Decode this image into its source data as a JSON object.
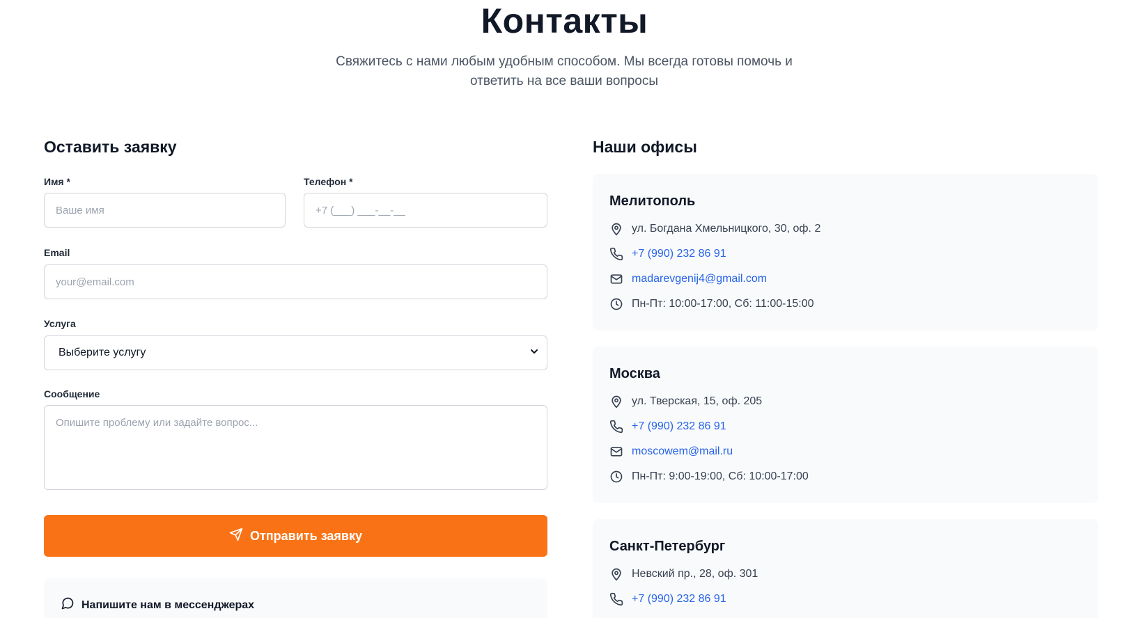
{
  "header": {
    "title": "Контакты",
    "subtitle": "Свяжитесь с нами любым удобным способом. Мы всегда готовы помочь и ответить на все ваши вопросы"
  },
  "form": {
    "title": "Оставить заявку",
    "name_label": "Имя *",
    "name_placeholder": "Ваше имя",
    "phone_label": "Телефон *",
    "phone_placeholder": "+7 (___) ___-__-__",
    "email_label": "Email",
    "email_placeholder": "your@email.com",
    "service_label": "Услуга",
    "service_value": "Выберите услугу",
    "message_label": "Сообщение",
    "message_placeholder": "Опишите проблему или задайте вопрос...",
    "submit_label": "Отправить заявку",
    "messenger_title": "Напишите нам в мессенджерах"
  },
  "offices": {
    "title": "Наши офисы",
    "items": [
      {
        "city": "Мелитополь",
        "address": "ул. Богдана Хмельницкого, 30, оф. 2",
        "phone": "+7 (990) 232 86 91",
        "email": "madarevgenij4@gmail.com",
        "hours": "Пн-Пт: 10:00-17:00, Сб: 11:00-15:00"
      },
      {
        "city": "Москва",
        "address": "ул. Тверская, 15, оф. 205",
        "phone": "+7 (990) 232 86 91",
        "email": "moscowem@mail.ru",
        "hours": "Пн-Пт: 9:00-19:00, Сб: 10:00-17:00"
      },
      {
        "city": "Санкт-Петербург",
        "address": "Невский пр., 28, оф. 301",
        "phone": "+7 (990) 232 86 91"
      }
    ]
  },
  "colors": {
    "accent": "#f97316",
    "link": "#2563eb",
    "card_bg": "#f9fafb"
  }
}
